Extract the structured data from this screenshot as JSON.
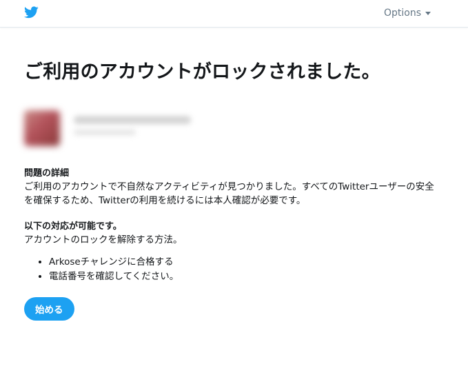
{
  "header": {
    "logo_icon": "twitter-bird-icon",
    "options_label": "Options",
    "brand_color": "#1da1f2"
  },
  "main": {
    "title": "ご利用のアカウントがロックされました。",
    "problem": {
      "heading": "問題の詳細",
      "body": "ご利用のアカウントで不自然なアクティビティが見つかりました。すべてのTwitterユーザーの安全を確保するため、Twitterの利用を続けるには本人確認が必要です。"
    },
    "actions": {
      "heading": "以下の対応が可能です。",
      "intro": "アカウントのロックを解除する方法。",
      "items": [
        "Arkoseチャレンジに合格する",
        "電話番号を確認してください。"
      ]
    },
    "start_button_label": "始める"
  }
}
